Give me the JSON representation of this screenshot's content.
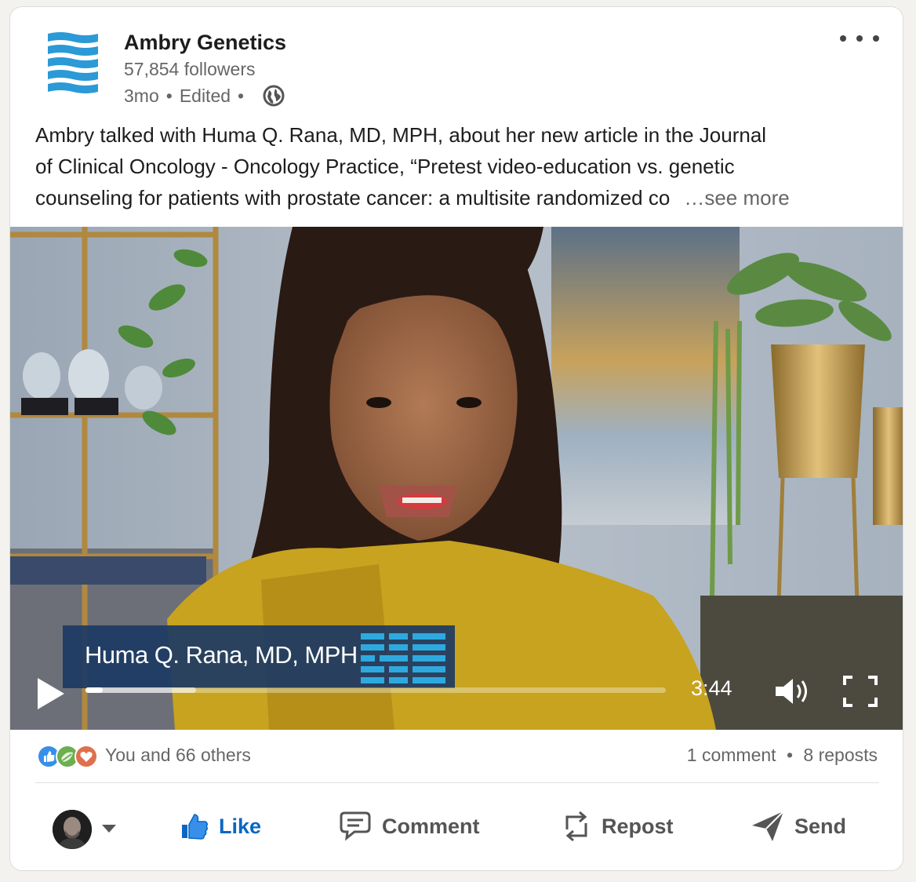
{
  "organization": {
    "name": "Ambry Genetics",
    "followers": "57,854 followers",
    "age": "3mo",
    "edited": "Edited",
    "visibility_icon": "globe-icon",
    "brand_color": "#2b9ad6"
  },
  "post": {
    "text_line1": "Ambry talked with Huma Q. Rana, MD, MPH, about her new article in the Journal",
    "text_line2": "of Clinical Oncology - Oncology Practice, “Pretest video-education vs. genetic",
    "text_line3": "counseling for patients with prostate cancer: a multisite randomized co",
    "see_more": "…see more"
  },
  "video": {
    "lower_third_name": "Huma Q. Rana, MD, MPH",
    "duration": "3:44",
    "played_fraction": 0.03,
    "buffered_fraction": 0.19,
    "controls": {
      "play_icon": "play-icon",
      "volume_icon": "volume-icon",
      "fullscreen_icon": "fullscreen-icon"
    }
  },
  "social_counts": {
    "reactions_text": "You and 66 others",
    "reaction_icons": [
      "like-reaction-icon",
      "support-reaction-icon",
      "love-reaction-icon"
    ],
    "comments": "1 comment",
    "reposts": "8 reposts",
    "separator": "•"
  },
  "actions": {
    "like": "Like",
    "comment": "Comment",
    "repost": "Repost",
    "send": "Send",
    "like_color": "#0a66c2"
  }
}
